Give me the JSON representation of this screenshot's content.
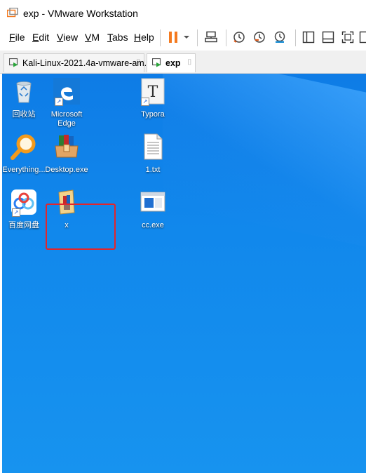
{
  "window": {
    "title": "exp - VMware Workstation"
  },
  "menu": [
    {
      "label": "File",
      "mnemonic": "F",
      "rest": "ile"
    },
    {
      "label": "Edit",
      "mnemonic": "E",
      "rest": "dit"
    },
    {
      "label": "View",
      "mnemonic": "V",
      "rest": "iew"
    },
    {
      "label": "VM",
      "mnemonic": "V",
      "rest": "M"
    },
    {
      "label": "Tabs",
      "mnemonic": "T",
      "rest": "abs"
    },
    {
      "label": "Help",
      "mnemonic": "H",
      "rest": "elp"
    }
  ],
  "tabs": [
    {
      "label": "Kali-Linux-2021.4a-vmware-am...",
      "close": "⌷",
      "active": false
    },
    {
      "label": "exp",
      "close": "⌷",
      "active": true
    }
  ],
  "desktop_icons": [
    {
      "label": "回收站"
    },
    {
      "label": "Microsoft Edge",
      "line1": "Microsoft",
      "line2": "Edge"
    },
    {
      "label": "Typora"
    },
    {
      "label": "Everything..."
    },
    {
      "label": "Desktop.exe"
    },
    {
      "label": "1.txt"
    },
    {
      "label": "百度网盘"
    },
    {
      "label": "x"
    },
    {
      "label": "cc.exe"
    }
  ],
  "colors": {
    "accent_pause": "#f47a1f",
    "desktop_blue": "#1188ec",
    "highlight_red": "#e3252b"
  }
}
